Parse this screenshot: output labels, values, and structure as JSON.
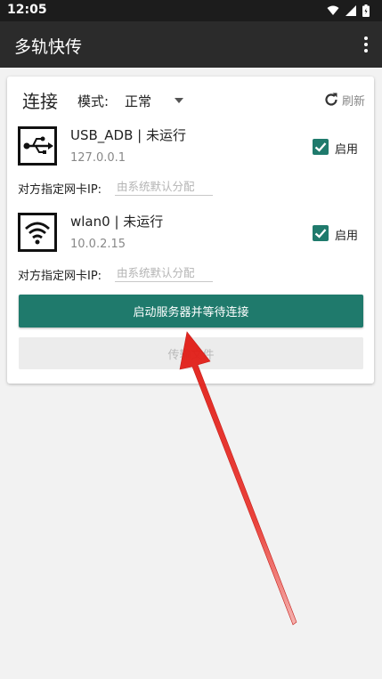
{
  "status_bar": {
    "time": "12:05"
  },
  "app_bar": {
    "title": "多轨快传"
  },
  "connection": {
    "title": "连接",
    "mode_label": "模式:",
    "mode_value": "正常",
    "refresh_label": "刷新"
  },
  "interfaces": [
    {
      "name": "USB_ADB | 未运行",
      "ip": "127.0.0.1",
      "enable_label": "启用",
      "enabled": true,
      "ip_label": "对方指定网卡IP:",
      "ip_placeholder": "由系统默认分配",
      "icon": "usb-icon"
    },
    {
      "name": "wlan0 | 未运行",
      "ip": "10.0.2.15",
      "enable_label": "启用",
      "enabled": true,
      "ip_label": "对方指定网卡IP:",
      "ip_placeholder": "由系统默认分配",
      "icon": "wifi-icon"
    }
  ],
  "buttons": {
    "start_server": "启动服务器并等待连接",
    "transfer_file": "传输文件"
  },
  "colors": {
    "accent": "#1f7a6c",
    "appbar": "#2b2b2b",
    "statusbar": "#1c1c1c",
    "arrow": "#e8241f"
  }
}
